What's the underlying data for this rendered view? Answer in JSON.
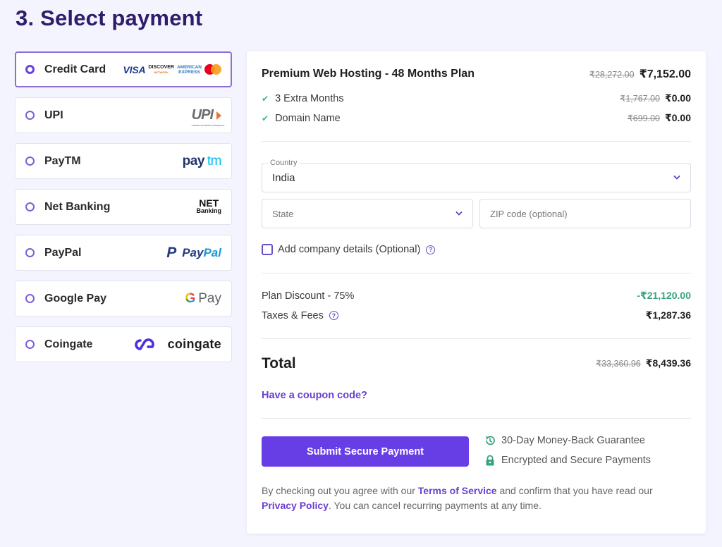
{
  "page": {
    "title": "3. Select payment"
  },
  "payment_methods": [
    {
      "id": "credit-card",
      "label": "Credit Card",
      "selected": true,
      "logo": {
        "visa": "VISA",
        "discover": "DISCOVER",
        "discover_sub": "NETWORK",
        "amex_1": "AMERICAN",
        "amex_2": "EXPRESS"
      }
    },
    {
      "id": "upi",
      "label": "UPI",
      "selected": false,
      "logo": {
        "text": "UPI",
        "sub": "UNIFIED PAYMENTS INTERFACE"
      }
    },
    {
      "id": "paytm",
      "label": "PayTM",
      "selected": false,
      "logo": {
        "a": "pay",
        "b": "tm"
      }
    },
    {
      "id": "net-banking",
      "label": "Net Banking",
      "selected": false,
      "logo": {
        "a": "NET",
        "b": "Banking"
      }
    },
    {
      "id": "paypal",
      "label": "PayPal",
      "selected": false,
      "logo": {
        "mark": "P",
        "a": "Pay",
        "b": "Pal"
      }
    },
    {
      "id": "google-pay",
      "label": "Google Pay",
      "selected": false,
      "logo": {
        "g": "G",
        "text": "Pay"
      }
    },
    {
      "id": "coingate",
      "label": "Coingate",
      "selected": false,
      "logo": {
        "text": "coingate"
      }
    }
  ],
  "summary": {
    "plan": {
      "name": "Premium Web Hosting - 48 Months Plan",
      "old_price": "₹28,272.00",
      "price": "₹7,152.00"
    },
    "extras": [
      {
        "label": "3 Extra Months",
        "old_price": "₹1,767.00",
        "price": "₹0.00"
      },
      {
        "label": "Domain Name",
        "old_price": "₹699.00",
        "price": "₹0.00"
      }
    ],
    "country": {
      "label": "Country",
      "value": "India"
    },
    "state": {
      "placeholder": "State"
    },
    "zip": {
      "placeholder": "ZIP code (optional)"
    },
    "company_details": {
      "label": "Add company details (Optional)",
      "checked": false
    },
    "discount": {
      "label": "Plan Discount - 75%",
      "value": "-₹21,120.00"
    },
    "taxes": {
      "label": "Taxes & Fees",
      "value": "₹1,287.36"
    },
    "total": {
      "label": "Total",
      "old_price": "₹33,360.96",
      "price": "₹8,439.36"
    },
    "coupon_link": "Have a coupon code?",
    "submit_label": "Submit Secure Payment",
    "guarantees": [
      {
        "icon": "history-icon",
        "text": "30-Day Money-Back Guarantee"
      },
      {
        "icon": "lock-icon",
        "text": "Encrypted and Secure Payments"
      }
    ],
    "legal": {
      "part1": "By checking out you agree with our ",
      "terms_link": "Terms of Service",
      "part2": " and confirm that you have read our ",
      "privacy_link": "Privacy Policy",
      "part3": ". You can cancel recurring payments at any time."
    }
  },
  "colors": {
    "accent": "#673de6",
    "title": "#2f1c6a",
    "success": "#36a57c",
    "background": "#f4f4fe"
  }
}
